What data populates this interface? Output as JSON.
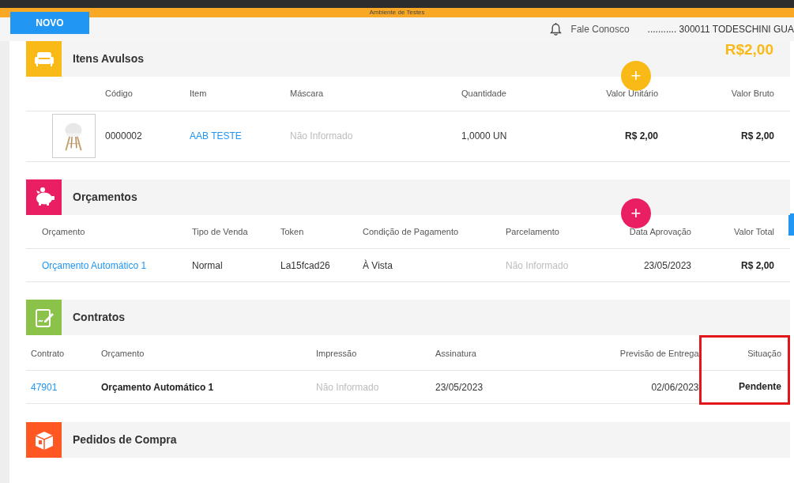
{
  "environment_bar": {
    "label": "Ambiente de Testes"
  },
  "new_button": {
    "label": "NOVO"
  },
  "header": {
    "contact_link": "Fale Conosco",
    "user": "........... 300011 TODESCHINI GUA"
  },
  "total": "R$2,00",
  "sections": [
    {
      "title": "Itens Avulsos",
      "color": "#f9b916",
      "add_button": "+",
      "columns": [
        {
          "kind": "picture"
        },
        {
          "label": "Código",
          "kind": "text"
        },
        {
          "label": "Item",
          "kind": "link"
        },
        {
          "label": "Máscara",
          "kind": "muted"
        },
        {
          "label": "Quantidade",
          "kind": "text"
        },
        {
          "label": "Valor Unitário",
          "kind": "bold"
        },
        {
          "label": "Valor Bruto",
          "kind": "bold"
        }
      ],
      "rows": [
        {
          "cells": [
            null,
            "0000002",
            "AAB TESTE",
            "Não Informado",
            "1,0000 UN",
            "R$ 2,00",
            "R$ 2,00"
          ]
        }
      ]
    },
    {
      "title": "Orçamentos",
      "color": "#e91e63",
      "add_button": "+",
      "columns": [
        {
          "label": "Orçamento",
          "kind": "link"
        },
        {
          "label": "Tipo de Venda",
          "kind": "text"
        },
        {
          "label": "Token",
          "kind": "text"
        },
        {
          "label": "Condição de Pagamento",
          "kind": "text"
        },
        {
          "label": "Parcelamento",
          "kind": "muted"
        },
        {
          "label": "Data Aprovação",
          "kind": "text"
        },
        {
          "label": "Valor Total",
          "kind": "bold"
        }
      ],
      "rows": [
        {
          "cells": [
            "Orçamento Automático 1",
            "Normal",
            "La15fcad26",
            "À Vista",
            "Não Informado",
            "23/05/2023",
            "R$ 2,00"
          ]
        }
      ]
    },
    {
      "title": "Contratos",
      "color": "#8bc34a",
      "columns": [
        {
          "label": "Contrato",
          "kind": "link"
        },
        {
          "label": "Orçamento",
          "kind": "bold"
        },
        {
          "label": "Impressão",
          "kind": "muted"
        },
        {
          "label": "Assinatura",
          "kind": "text"
        },
        {
          "label": "Previsão de Entrega",
          "kind": "text"
        },
        {
          "label": "Situação",
          "kind": "bold",
          "highlighted": true
        }
      ],
      "rows": [
        {
          "cells": [
            "47901",
            "Orçamento Automático 1",
            "Não Informado",
            "23/05/2023",
            "02/06/2023",
            "Pendente"
          ]
        }
      ]
    },
    {
      "title": "Pedidos de Compra",
      "color": "#ff5722"
    }
  ]
}
